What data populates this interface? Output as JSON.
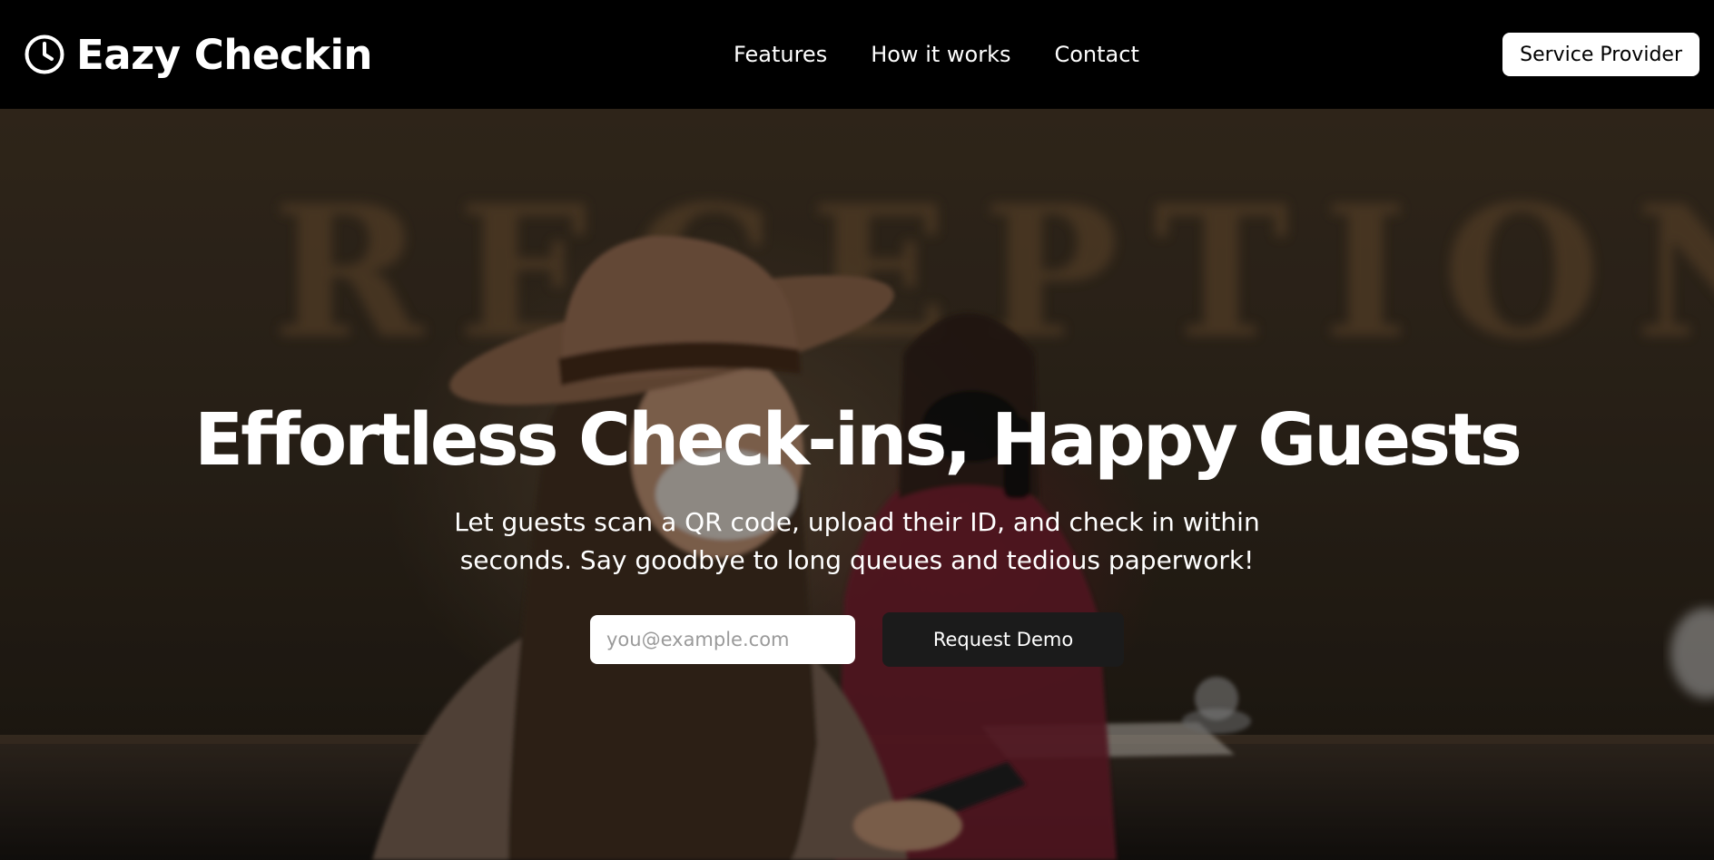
{
  "header": {
    "brand_name": "Eazy Checkin",
    "brand_icon": "clock-icon",
    "nav": [
      {
        "label": "Features"
      },
      {
        "label": "How it works"
      },
      {
        "label": "Contact"
      }
    ],
    "provider_button": "Service Provider"
  },
  "hero": {
    "background_text": "RECEPTION",
    "title": "Effortless Check-ins, Happy Guests",
    "subtitle": "Let guests scan a QR code, upload their ID, and check in within seconds. Say goodbye to long queues and tedious paperwork!",
    "email_placeholder": "you@example.com",
    "demo_button": "Request Demo"
  },
  "colors": {
    "header_bg": "#000000",
    "text": "#ffffff",
    "demo_button_bg": "#1b1b1b"
  }
}
